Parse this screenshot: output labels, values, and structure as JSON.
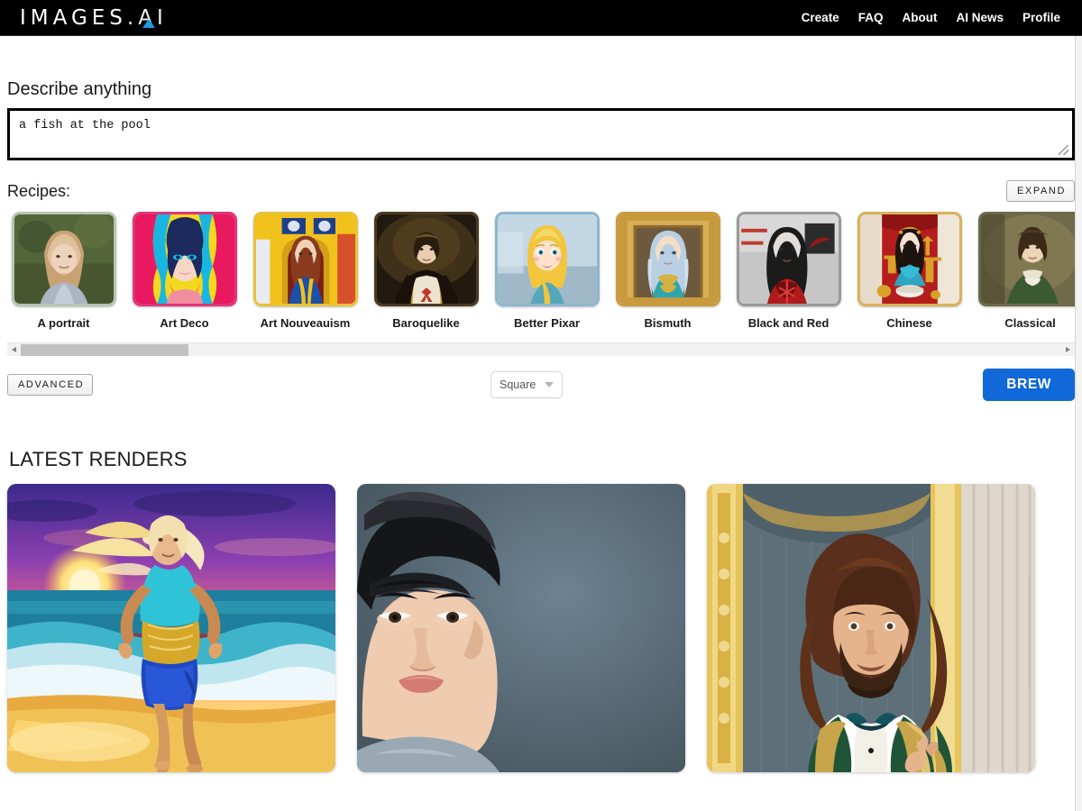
{
  "brand": {
    "logo_main": "IMAGES.",
    "logo_ai": "AI",
    "accent_color": "#1a9be0"
  },
  "nav": {
    "items": [
      {
        "label": "Create"
      },
      {
        "label": "FAQ"
      },
      {
        "label": "About"
      },
      {
        "label": "AI News"
      },
      {
        "label": "Profile"
      }
    ]
  },
  "prompt": {
    "label": "Describe anything",
    "value": "a fish at the pool",
    "placeholder": "Describe anything"
  },
  "recipes": {
    "title": "Recipes:",
    "expand_label": "EXPAND",
    "items": [
      {
        "label": "A portrait"
      },
      {
        "label": "Art Deco"
      },
      {
        "label": "Art Nouveauism"
      },
      {
        "label": "Baroquelike"
      },
      {
        "label": "Better Pixar"
      },
      {
        "label": "Bismuth"
      },
      {
        "label": "Black and Red"
      },
      {
        "label": "Chinese"
      },
      {
        "label": "Classical"
      }
    ]
  },
  "controls": {
    "advanced_label": "ADVANCED",
    "aspect_selected": "Square",
    "aspect_options": [
      "Square"
    ],
    "brew_label": "BREW",
    "brew_color": "#1168d8"
  },
  "renders": {
    "title": "LATEST RENDERS",
    "items": [
      {
        "alt": "woman running on beach at sunset"
      },
      {
        "alt": "portrait of man on slate blue background"
      },
      {
        "alt": "bearded man in green and gold suit"
      }
    ]
  }
}
